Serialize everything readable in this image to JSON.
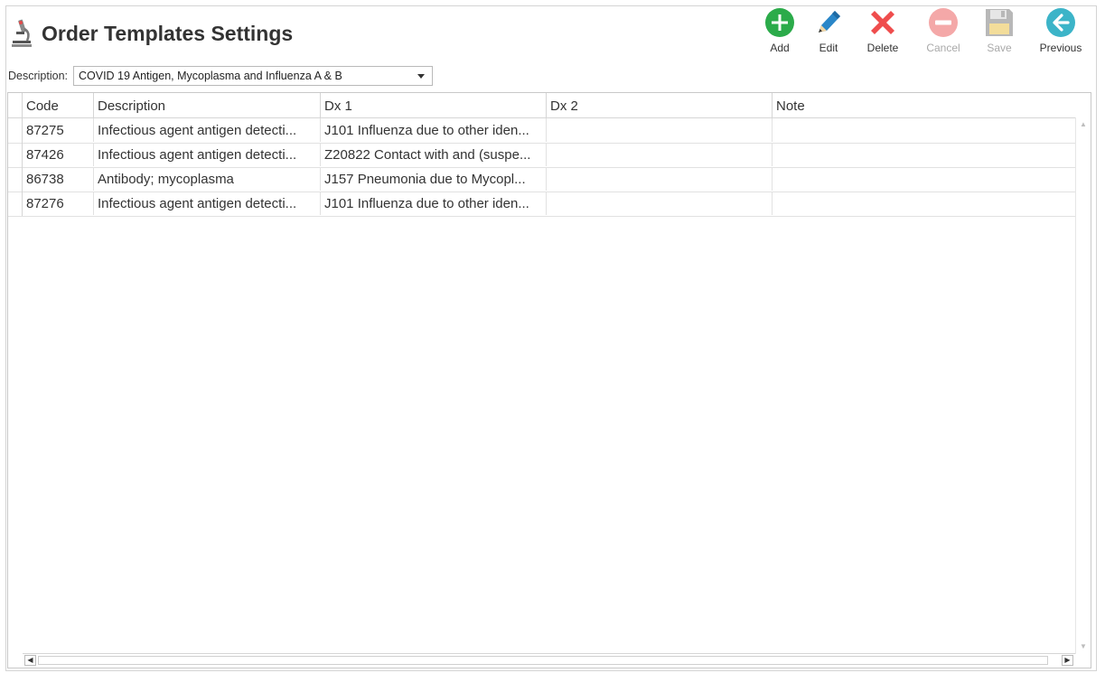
{
  "header": {
    "title": "Order Templates Settings",
    "icon": "microscope-icon"
  },
  "toolbar": {
    "add_label": "Add",
    "edit_label": "Edit",
    "delete_label": "Delete",
    "cancel_label": "Cancel",
    "save_label": "Save",
    "previous_label": "Previous",
    "colors": {
      "add": "#2bab4a",
      "edit": "#2a86c8",
      "delete": "#ef4d4d",
      "cancel_disabled": "#f4a8a8",
      "save_disabled": "#b8b8b8",
      "previous": "#3cb4c8"
    }
  },
  "filter": {
    "label": "Description:",
    "selected": "COVID 19 Antigen, Mycoplasma and Influenza A & B"
  },
  "grid": {
    "columns": [
      "Code",
      "Description",
      "Dx 1",
      "Dx 2",
      "Note"
    ],
    "rows": [
      [
        "87275",
        "Infectious agent antigen detecti...",
        "J101 Influenza due to other iden...",
        "",
        ""
      ],
      [
        "87426",
        "Infectious agent antigen detecti...",
        "Z20822 Contact with and (suspe...",
        "",
        ""
      ],
      [
        "86738",
        "Antibody; mycoplasma",
        "J157 Pneumonia due to Mycopl...",
        "",
        ""
      ],
      [
        "87276",
        "Infectious agent antigen detecti...",
        "J101 Influenza due to other iden...",
        "",
        ""
      ]
    ]
  }
}
